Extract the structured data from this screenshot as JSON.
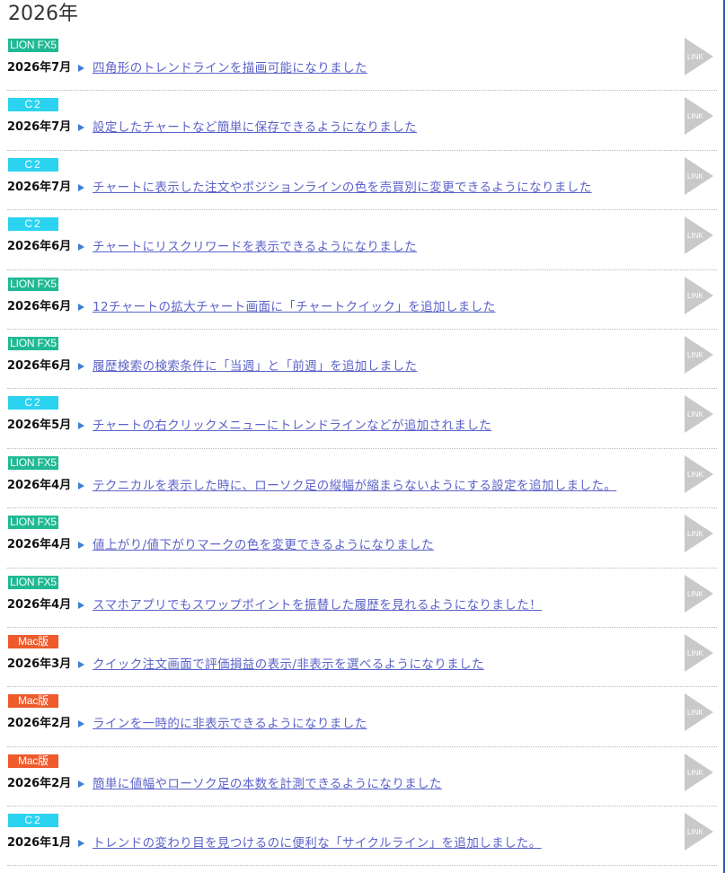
{
  "year_heading": "2026年",
  "link_label": "LINK",
  "items": [
    {
      "badge": "LION FX5",
      "type": "fx5",
      "date": "2026年7月",
      "title": "四角形のトレンドラインを描画可能になりました"
    },
    {
      "badge": "C2",
      "type": "c2",
      "date": "2026年7月",
      "title": "設定したチャートなど簡単に保存できるようになりました"
    },
    {
      "badge": "C2",
      "type": "c2",
      "date": "2026年7月",
      "title": "チャートに表示した注文やポジションラインの色を売買別に変更できるようになりました"
    },
    {
      "badge": "C2",
      "type": "c2",
      "date": "2026年6月",
      "title": "チャートにリスクリワードを表示できるようになりました"
    },
    {
      "badge": "LION FX5",
      "type": "fx5",
      "date": "2026年6月",
      "title": "12チャートの拡大チャート画面に「チャートクイック」を追加しました"
    },
    {
      "badge": "LION FX5",
      "type": "fx5",
      "date": "2026年6月",
      "title": "履歴検索の検索条件に「当週」と「前週」を追加しました"
    },
    {
      "badge": "C2",
      "type": "c2",
      "date": "2026年5月",
      "title": "チャートの右クリックメニューにトレンドラインなどが追加されました"
    },
    {
      "badge": "LION FX5",
      "type": "fx5",
      "date": "2026年4月",
      "title": "テクニカルを表示した時に、ローソク足の縦幅が縮まらないようにする設定を追加しました。"
    },
    {
      "badge": "LION FX5",
      "type": "fx5",
      "date": "2026年4月",
      "title": "値上がり/値下がりマークの色を変更できるようになりました"
    },
    {
      "badge": "LION FX5",
      "type": "fx5",
      "date": "2026年4月",
      "title": "スマホアプリでもスワップポイントを振替した履歴を見れるようになりました！"
    },
    {
      "badge": "Mac版",
      "type": "mac",
      "date": "2026年3月",
      "title": "クイック注文画面で評価損益の表示/非表示を選べるようになりました"
    },
    {
      "badge": "Mac版",
      "type": "mac",
      "date": "2026年2月",
      "title": "ラインを一時的に非表示できるようになりました"
    },
    {
      "badge": "Mac版",
      "type": "mac",
      "date": "2026年2月",
      "title": "簡単に値幅やローソク足の本数を計測できるようになりました"
    },
    {
      "badge": "C2",
      "type": "c2",
      "date": "2026年1月",
      "title": "トレンドの変わり目を見つけるのに便利な「サイクルライン」を追加しました。"
    }
  ],
  "colors": {
    "fx5": "#1fb993",
    "c2": "#2bd3f0",
    "mac": "#ee5a2b",
    "link": "#5b63c9"
  }
}
